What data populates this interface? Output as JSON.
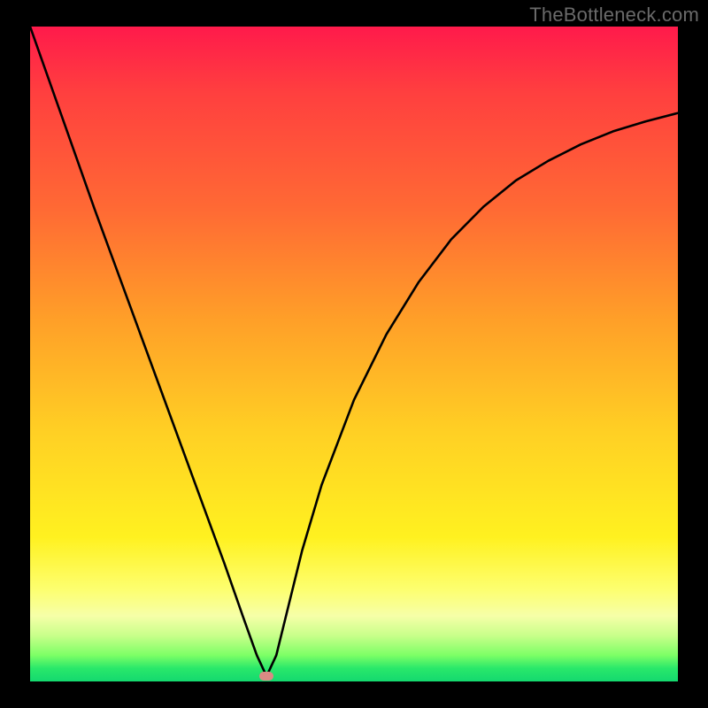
{
  "watermark": "TheBottleneck.com",
  "chart_data": {
    "type": "line",
    "title": "",
    "xlabel": "",
    "ylabel": "",
    "xlim": [
      0,
      100
    ],
    "ylim": [
      0,
      100
    ],
    "grid": false,
    "series": [
      {
        "name": "bottleneck-curve",
        "x": [
          0,
          5,
          10,
          15,
          20,
          25,
          30,
          33,
          35,
          36.5,
          38,
          40,
          42,
          45,
          50,
          55,
          60,
          65,
          70,
          75,
          80,
          85,
          90,
          95,
          100
        ],
        "values": [
          100,
          86,
          72,
          58.5,
          45,
          31.5,
          18,
          9.5,
          4,
          0.8,
          4,
          12,
          20,
          30,
          43,
          53,
          61,
          67.5,
          72.5,
          76.5,
          79.5,
          82,
          84,
          85.5,
          86.8
        ]
      }
    ],
    "minimum_marker": {
      "x": 36.5,
      "y": 0.8,
      "color": "#d98a84"
    },
    "background_gradient_domain": "bottleneck-heatmap"
  }
}
